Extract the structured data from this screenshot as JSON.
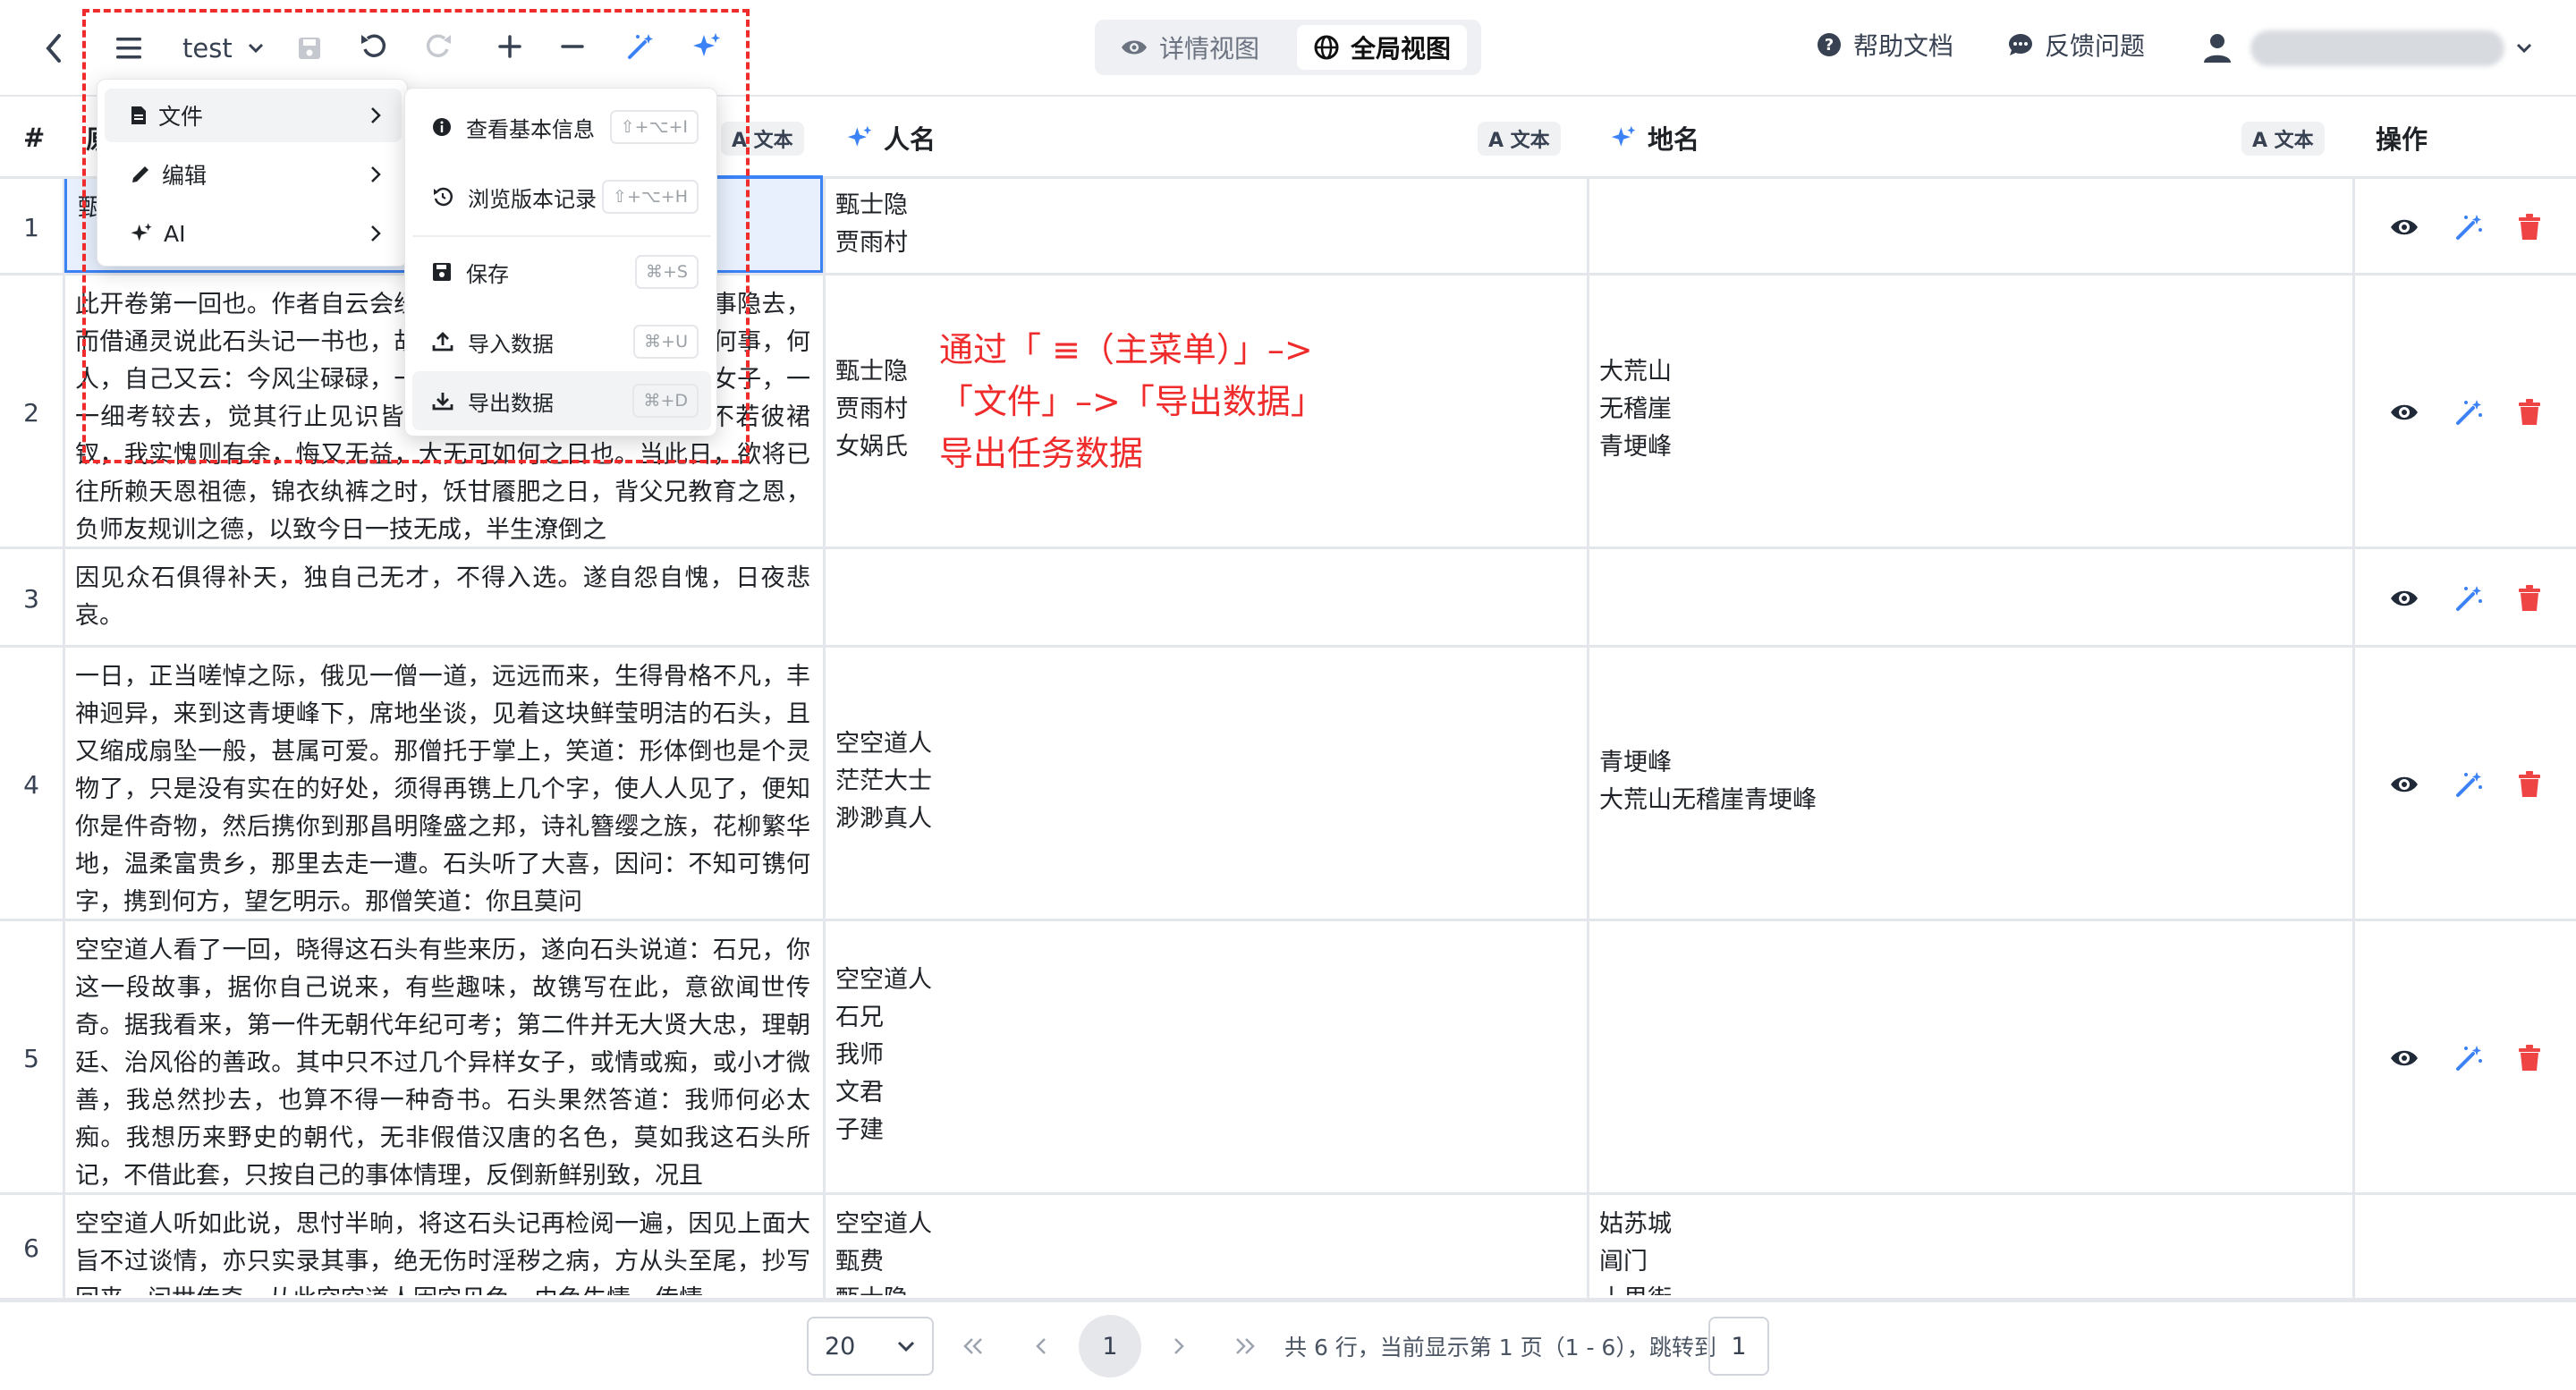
{
  "toolbar": {
    "project_name": "test",
    "view_detail": "详情视图",
    "view_global": "全局视图",
    "help": "帮助文档",
    "feedback": "反馈问题"
  },
  "columns": {
    "index": "#",
    "text_col": "原文",
    "person": "人名",
    "place": "地名",
    "type_badge": "A 文本",
    "actions": "操作"
  },
  "rows": [
    {
      "n": "1",
      "text": "甄",
      "person": "甄士隐\n贾雨村",
      "place": ""
    },
    {
      "n": "2",
      "text": "此开卷第一回也。作者自云会经历过一番梦幻之后，故将真事隐去，而借通灵说此石头记一书也，故曰甄士隐云云。但书中所记何事，何人，自己又云：今风尘碌碌，一事无成，忽念及当日所有之女子，一一细考较去，觉其行止见识皆出我之上。我堂堂须眉，诚不若彼裙钗，我实愧则有余，悔又无益，大无可如何之日也。当此日，欲将已往所赖天恩祖德，锦衣纨裤之时，饫甘餍肥之日，背父兄教育之恩，负师友规训之德，以致今日一技无成，半生潦倒之",
      "person": "甄士隐\n贾雨村\n女娲氏",
      "place": "大荒山\n无稽崖\n青埂峰"
    },
    {
      "n": "3",
      "text": "因见众石俱得补天，独自己无才，不得入选。遂自怨自愧，日夜悲哀。",
      "person": "",
      "place": ""
    },
    {
      "n": "4",
      "text": "一日，正当嗟悼之际，俄见一僧一道，远远而来，生得骨格不凡，丰神迥异，来到这青埂峰下，席地坐谈，见着这块鲜莹明洁的石头，且又缩成扇坠一般，甚属可爱。那僧托于掌上，笑道：形体倒也是个灵物了，只是没有实在的好处，须得再镌上几个字，使人人见了，便知你是件奇物，然后携你到那昌明隆盛之邦，诗礼簪缨之族，花柳繁华地，温柔富贵乡，那里去走一遭。石头听了大喜，因问：不知可镌何字，携到何方，望乞明示。那僧笑道：你且莫问",
      "person": "空空道人\n茫茫大士\n渺渺真人",
      "place": "青埂峰\n大荒山无稽崖青埂峰"
    },
    {
      "n": "5",
      "text": "空空道人看了一回，晓得这石头有些来历，遂向石头说道：石兄，你这一段故事，据你自己说来，有些趣味，故镌写在此，意欲闻世传奇。据我看来，第一件无朝代年纪可考；第二件并无大贤大忠，理朝廷、治风俗的善政。其中只不过几个异样女子，或情或痴，或小才微善，我总然抄去，也算不得一种奇书。石头果然答道：我师何必太痴。我想历来野史的朝代，无非假借汉唐的名色，莫如我这石头所记，不借此套，只按自己的事体情理，反倒新鲜别致，况且",
      "person": "空空道人\n石兄\n我师\n文君\n子建",
      "place": ""
    },
    {
      "n": "6",
      "text": "空空道人听如此说，思忖半晌，将这石头记再检阅一遍，因见上面大旨不过谈情，亦只实录其事，绝无伤时淫秽之病，方从头至尾，抄写回来，问世传奇。从此空空道人因空见色，由色生情，传情",
      "person": "空空道人\n甄费\n甄士隐",
      "place": "姑苏城\n阊门\n十里街"
    }
  ],
  "menu": {
    "main": [
      {
        "label": "文件"
      },
      {
        "label": "编辑"
      },
      {
        "label": "AI"
      }
    ],
    "file": [
      {
        "label": "查看基本信息",
        "shortcut": "⇧+⌥+I"
      },
      {
        "label": "浏览版本记录",
        "shortcut": "⇧+⌥+H"
      },
      {
        "label": "保存",
        "shortcut": "⌘+S"
      },
      {
        "label": "导入数据",
        "shortcut": "⌘+U"
      },
      {
        "label": "导出数据",
        "shortcut": "⌘+D"
      }
    ]
  },
  "annotation": "通过「 ≡（主菜单）」–>\n「文件」–>「导出数据」\n导出任务数据",
  "pagination": {
    "page_size": "20",
    "current_page": "1",
    "summary": "共 6 行，当前显示第 1 页（1 - 6），跳转到",
    "jump_value": "1"
  },
  "colors": {
    "accent": "#3b82f6",
    "danger": "#ef4444",
    "annotation": "#ef2b2b"
  }
}
